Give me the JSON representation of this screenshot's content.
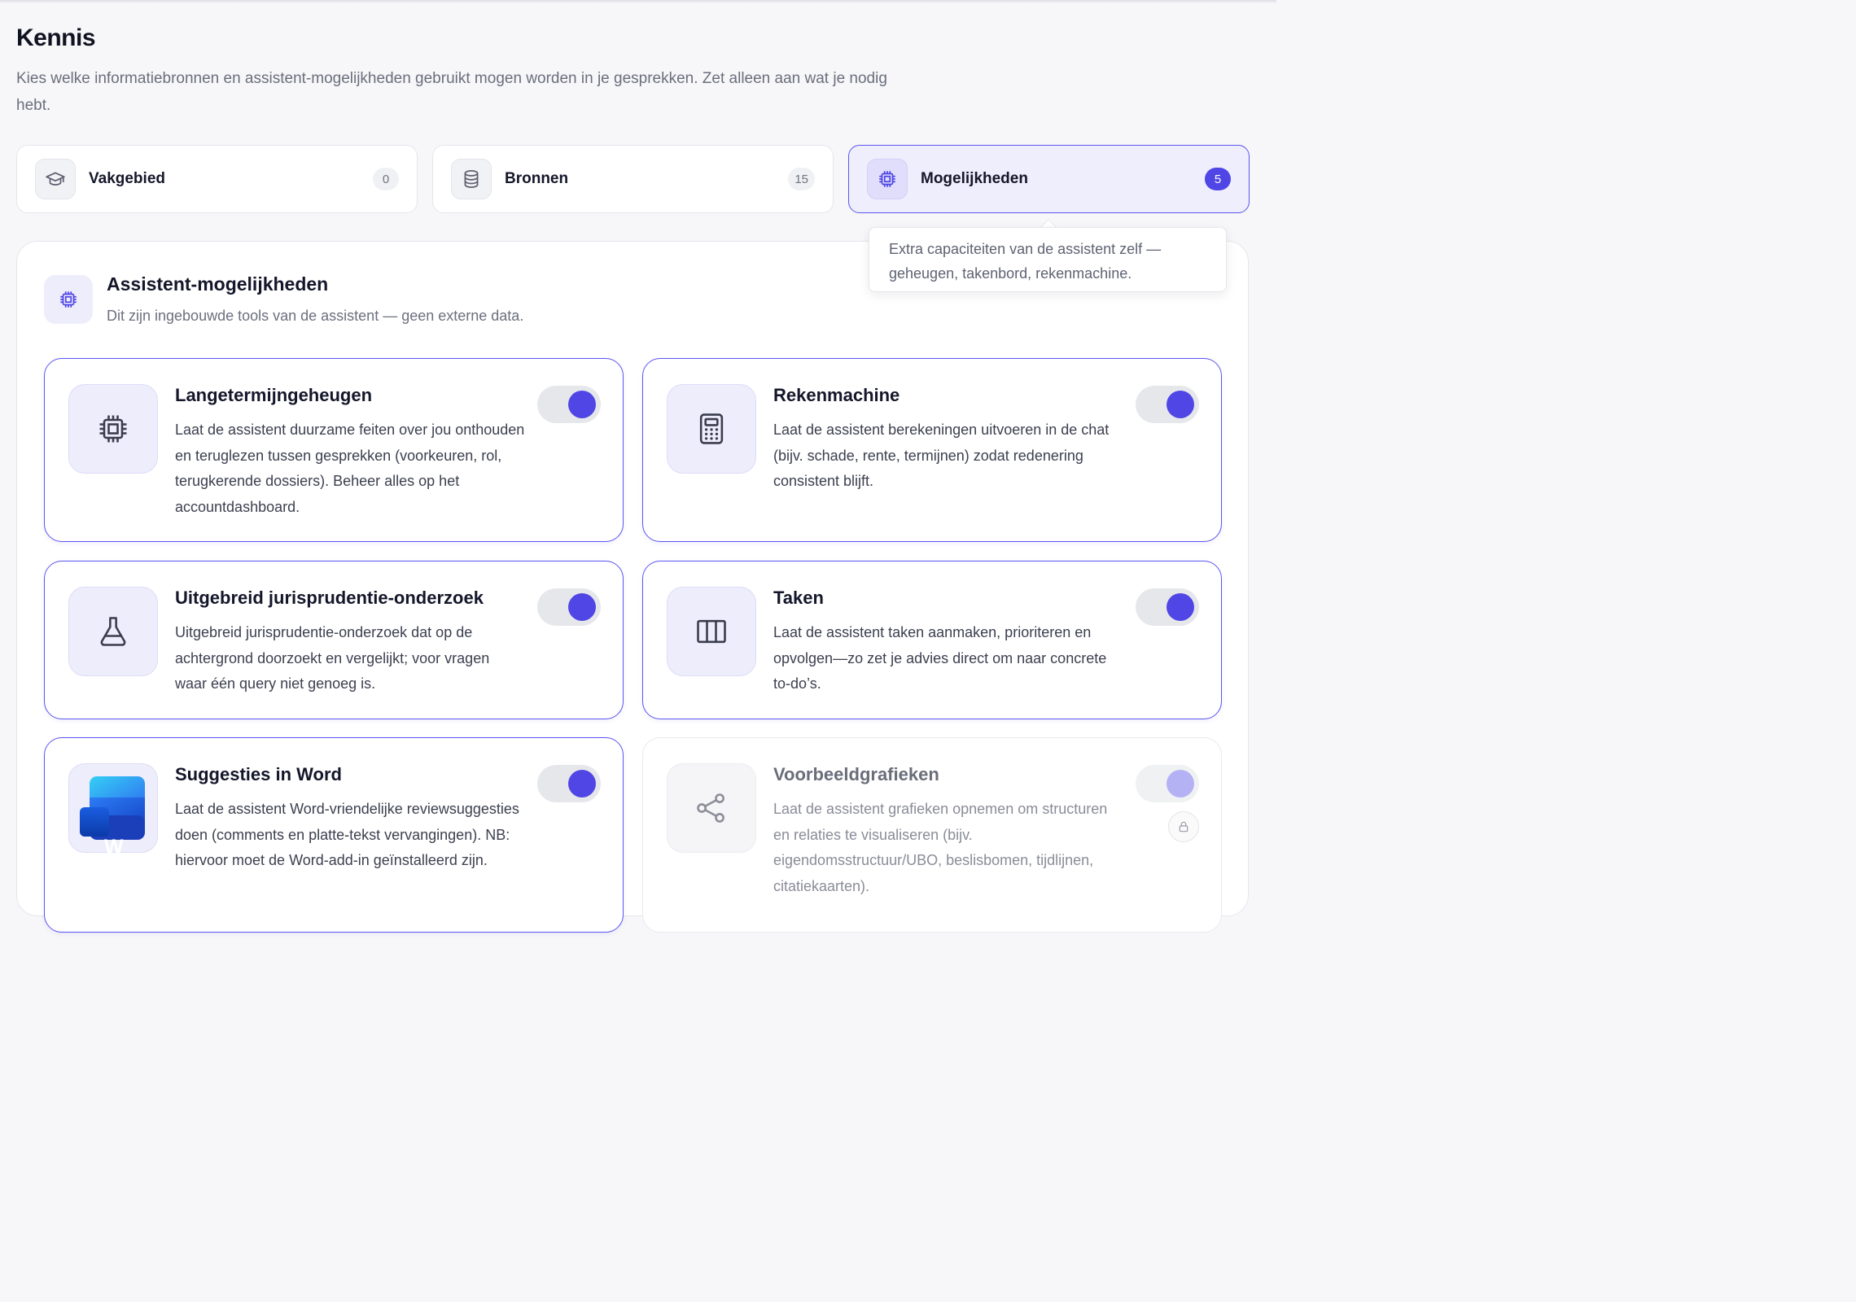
{
  "header": {
    "title": "Kennis",
    "description": "Kies welke informatiebronnen en assistent-mogelijkheden gebruikt mogen worden in je gesprekken. Zet alleen aan wat je nodig hebt."
  },
  "tabs": [
    {
      "label": "Vakgebied",
      "count": "0",
      "icon": "graduation-cap-icon"
    },
    {
      "label": "Bronnen",
      "count": "15",
      "icon": "database-icon"
    },
    {
      "label": "Mogelijkheden",
      "count": "5",
      "icon": "chip-icon",
      "active": true
    }
  ],
  "tooltip": {
    "text": "Extra capaciteiten van de assistent zelf — geheugen, takenbord, rekenmachine."
  },
  "section": {
    "title": "Assistent-mogelijkheden",
    "subtitle": "Dit zijn ingebouwde tools van de assistent — geen externe data.",
    "icon": "chip-icon"
  },
  "capabilities": [
    {
      "title": "Langetermijngeheugen",
      "description": "Laat de assistent duurzame feiten over jou onthouden en teruglezen tussen gesprekken (voorkeuren, rol, terugkerende dossiers). Beheer alles op het accountdashboard.",
      "icon": "chip-icon",
      "enabled": true
    },
    {
      "title": "Rekenmachine",
      "description": "Laat de assistent berekeningen uitvoeren in de chat (bijv. schade, rente, termijnen) zodat redenering consistent blijft.",
      "icon": "calculator-icon",
      "enabled": true
    },
    {
      "title": "Uitgebreid jurisprudentie-onderzoek",
      "description": "Uitgebreid jurisprudentie-onderzoek dat op de achtergrond doorzoekt en vergelijkt; voor vragen waar één query niet genoeg is.",
      "icon": "flask-icon",
      "enabled": true
    },
    {
      "title": "Taken",
      "description": "Laat de assistent taken aanmaken, prioriteren en opvolgen—zo zet je advies direct om naar concrete to-do’s.",
      "icon": "kanban-icon",
      "enabled": true
    },
    {
      "title": "Suggesties in Word",
      "description": "Laat de assistent Word-vriendelijke reviewsuggesties doen (comments en platte-tekst vervangingen). NB: hiervoor moet de Word-add-in geïnstalleerd zijn.",
      "icon": "word-logo-icon",
      "icon_letter": "W",
      "enabled": true
    },
    {
      "title": "Voorbeeldgrafieken",
      "description": "Laat de assistent grafieken opnemen om structuren en relaties te visualiseren (bijv. eigendomsstructuur/UBO, beslisbomen, tijdlijnen, citatiekaarten).",
      "icon": "share-nodes-icon",
      "enabled": true,
      "locked": true,
      "lock_icon": "lock-icon"
    }
  ],
  "colors": {
    "accent": "#4f46e5",
    "accent_border": "#5b55f0",
    "accent_soft": "#eeedfc",
    "background": "#f7f7f9",
    "text": "#14162a",
    "muted": "#6b6e7d"
  }
}
